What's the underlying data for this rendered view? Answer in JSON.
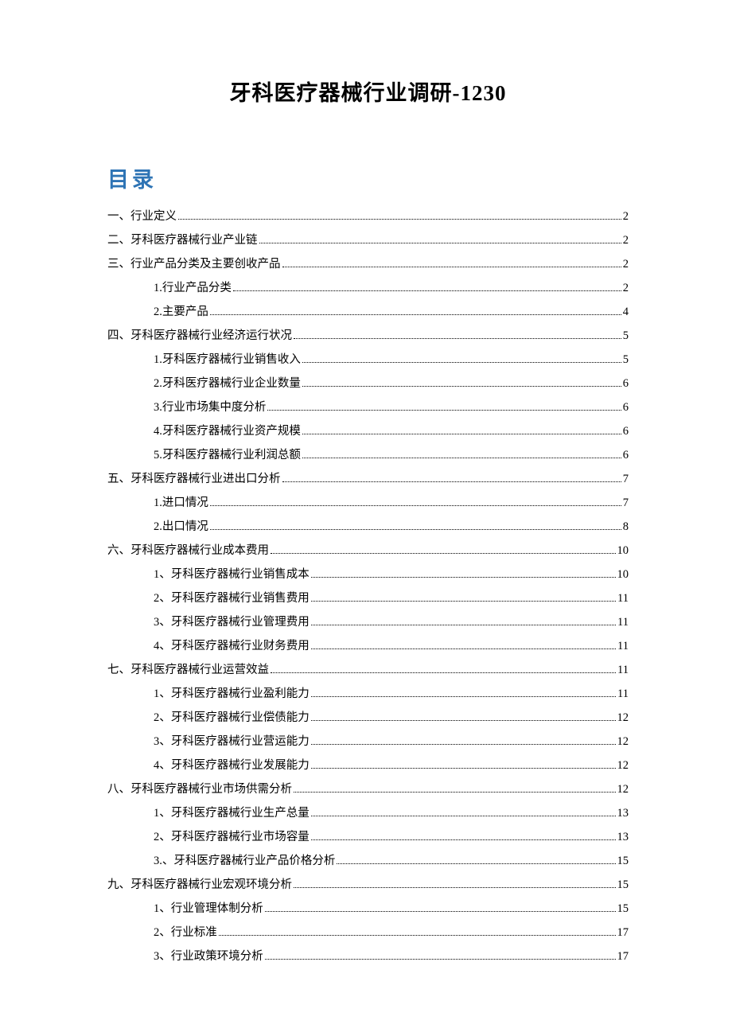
{
  "title": "牙科医疗器械行业调研-1230",
  "toc_heading": "目录",
  "toc": [
    {
      "level": 1,
      "label": "一、行业定义",
      "page": "2"
    },
    {
      "level": 1,
      "label": "二、牙科医疗器械行业产业链",
      "page": "2"
    },
    {
      "level": 1,
      "label": "三、行业产品分类及主要创收产品",
      "page": "2"
    },
    {
      "level": 2,
      "label": "1.行业产品分类",
      "page": "2"
    },
    {
      "level": 2,
      "label": "2.主要产品",
      "page": "4"
    },
    {
      "level": 1,
      "label": "四、牙科医疗器械行业经济运行状况",
      "page": "5"
    },
    {
      "level": 2,
      "label": "1.牙科医疗器械行业销售收入",
      "page": "5"
    },
    {
      "level": 2,
      "label": "2.牙科医疗器械行业企业数量",
      "page": "6"
    },
    {
      "level": 2,
      "label": "3.行业市场集中度分析",
      "page": "6"
    },
    {
      "level": 2,
      "label": "4.牙科医疗器械行业资产规模",
      "page": "6"
    },
    {
      "level": 2,
      "label": "5.牙科医疗器械行业利润总额",
      "page": "6"
    },
    {
      "level": 1,
      "label": "五、牙科医疗器械行业进出口分析",
      "page": "7"
    },
    {
      "level": 2,
      "label": "1.进口情况",
      "page": "7"
    },
    {
      "level": 2,
      "label": "2.出口情况",
      "page": "8"
    },
    {
      "level": 1,
      "label": "六、牙科医疗器械行业成本费用",
      "page": "10"
    },
    {
      "level": 2,
      "label": "1、牙科医疗器械行业销售成本",
      "page": "10"
    },
    {
      "level": 2,
      "label": "2、牙科医疗器械行业销售费用",
      "page": "11"
    },
    {
      "level": 2,
      "label": "3、牙科医疗器械行业管理费用",
      "page": "11"
    },
    {
      "level": 2,
      "label": "4、牙科医疗器械行业财务费用",
      "page": "11"
    },
    {
      "level": 1,
      "label": "七、牙科医疗器械行业运营效益",
      "page": "11"
    },
    {
      "level": 2,
      "label": "1、牙科医疗器械行业盈利能力",
      "page": "11"
    },
    {
      "level": 2,
      "label": "2、牙科医疗器械行业偿债能力",
      "page": "12"
    },
    {
      "level": 2,
      "label": "3、牙科医疗器械行业营运能力",
      "page": "12"
    },
    {
      "level": 2,
      "label": "4、牙科医疗器械行业发展能力",
      "page": "12"
    },
    {
      "level": 1,
      "label": "八、牙科医疗器械行业市场供需分析",
      "page": "12"
    },
    {
      "level": 2,
      "label": "1、牙科医疗器械行业生产总量",
      "page": "13"
    },
    {
      "level": 2,
      "label": "2、牙科医疗器械行业市场容量",
      "page": "13"
    },
    {
      "level": 2,
      "label": "3.、牙科医疗器械行业产品价格分析",
      "page": "15"
    },
    {
      "level": 1,
      "label": "九、牙科医疗器械行业宏观环境分析",
      "page": "15"
    },
    {
      "level": 2,
      "label": "1、行业管理体制分析",
      "page": "15"
    },
    {
      "level": 2,
      "label": "2、行业标准",
      "page": "17"
    },
    {
      "level": 2,
      "label": "3、行业政策环境分析",
      "page": "17"
    }
  ]
}
